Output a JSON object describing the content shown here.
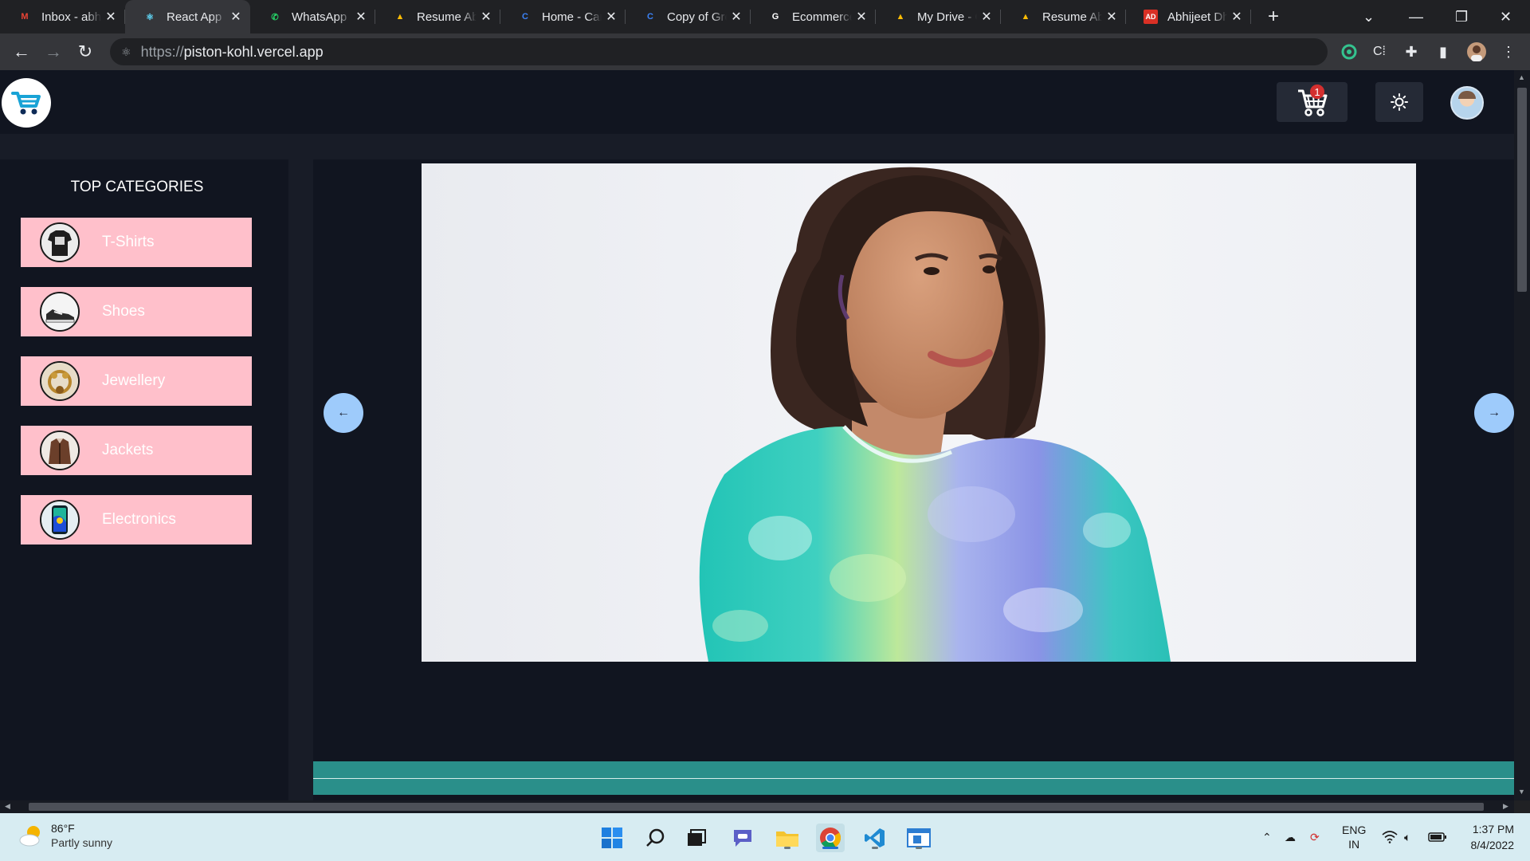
{
  "browser": {
    "tabs": [
      {
        "title": "Inbox - abhijeet",
        "icon": "gmail-icon",
        "color": "#ea4335",
        "glyph": "M"
      },
      {
        "title": "React App",
        "icon": "react-icon",
        "color": "#61dafb",
        "glyph": "⚛"
      },
      {
        "title": "WhatsApp",
        "icon": "whatsapp-icon",
        "color": "#25d366",
        "glyph": "✆"
      },
      {
        "title": "Resume Abhijeet",
        "icon": "google-drive-icon",
        "color": "#fbbc04",
        "glyph": "▲"
      },
      {
        "title": "Home - Canva",
        "icon": "canva-icon",
        "color": "#3b82f6",
        "glyph": "C"
      },
      {
        "title": "Copy of Green",
        "icon": "canva-icon",
        "color": "#3b82f6",
        "glyph": "C"
      },
      {
        "title": "Ecommerce",
        "icon": "google-icon",
        "color": "#ffffff",
        "glyph": "G"
      },
      {
        "title": "My Drive - Google",
        "icon": "google-drive-icon",
        "color": "#fbbc04",
        "glyph": "▲"
      },
      {
        "title": "Resume Abhijeet",
        "icon": "google-drive-icon",
        "color": "#fbbc04",
        "glyph": "▲"
      },
      {
        "title": "Abhijeet Dhas",
        "icon": "ad-icon",
        "color": "#d93025",
        "glyph": "AD"
      }
    ],
    "active_tab": 1,
    "url_protocol": "https://",
    "url_host": "piston-kohl.vercel.app"
  },
  "app": {
    "cart_count": "1",
    "sidebar_title": "TOP CATEGORIES",
    "categories": [
      {
        "label": "T-Shirts",
        "icon": "tshirt-icon"
      },
      {
        "label": "Shoes",
        "icon": "shoe-icon"
      },
      {
        "label": "Jewellery",
        "icon": "jewellery-icon"
      },
      {
        "label": "Jackets",
        "icon": "jacket-icon"
      },
      {
        "label": "Electronics",
        "icon": "phone-icon"
      }
    ],
    "colors": {
      "category_bg": "#ffc0cb",
      "arrow_bg": "#9ecbfb",
      "footer_bar": "#2a8f8a"
    }
  },
  "taskbar": {
    "temperature": "86°F",
    "weather": "Partly sunny",
    "language": "ENG",
    "region": "IN",
    "time": "1:37 PM",
    "date": "8/4/2022"
  }
}
